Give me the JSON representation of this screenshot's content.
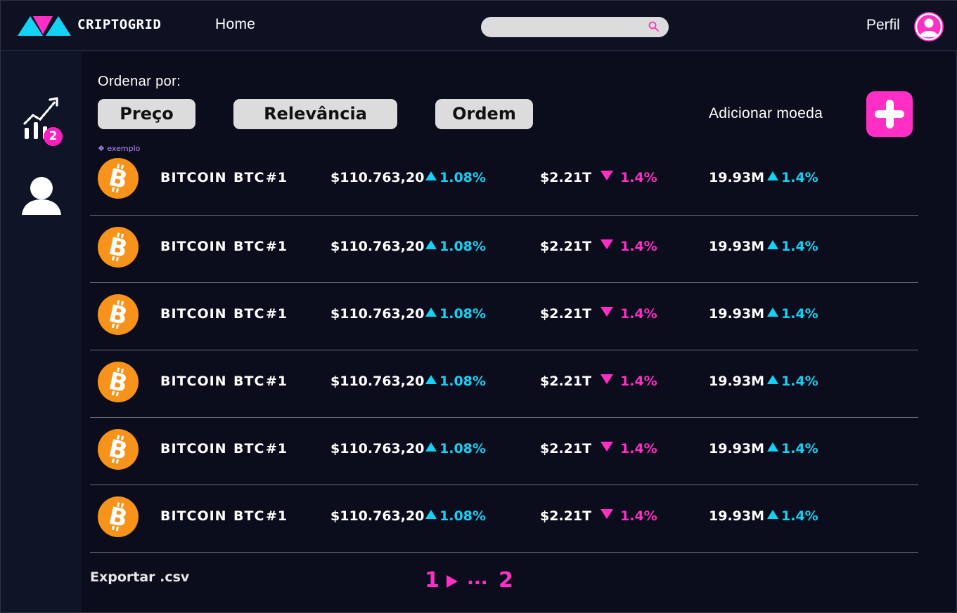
{
  "header": {
    "brand": "CRIPTOGRID",
    "nav_home": "Home",
    "search_placeholder": "",
    "profile_label": "Perfil"
  },
  "sidebar": {
    "badge_count": "2"
  },
  "toolbar": {
    "sort_label": "Ordenar por:",
    "sort_buttons": [
      "Preço",
      "Relevância",
      "Ordem"
    ],
    "add_label": "Adicionar moeda",
    "example_tag": "❖ exemplo"
  },
  "colors": {
    "accent_pink": "#ff2fc6",
    "accent_cyan": "#14d2f5",
    "bitcoin_orange": "#f7931a"
  },
  "coins": [
    {
      "name": "BITCOIN",
      "symbol": "BTC",
      "rank": "#1",
      "price": "$110.763,20",
      "change_price": "1.08%",
      "market_cap": "$2.21T",
      "change_cap": "1.4%",
      "volume": "19.93M",
      "change_volume": "1.4%"
    },
    {
      "name": "BITCOIN",
      "symbol": "BTC",
      "rank": "#1",
      "price": "$110.763,20",
      "change_price": "1.08%",
      "market_cap": "$2.21T",
      "change_cap": "1.4%",
      "volume": "19.93M",
      "change_volume": "1.4%"
    },
    {
      "name": "BITCOIN",
      "symbol": "BTC",
      "rank": "#1",
      "price": "$110.763,20",
      "change_price": "1.08%",
      "market_cap": "$2.21T",
      "change_cap": "1.4%",
      "volume": "19.93M",
      "change_volume": "1.4%"
    },
    {
      "name": "BITCOIN",
      "symbol": "BTC",
      "rank": "#1",
      "price": "$110.763,20",
      "change_price": "1.08%",
      "market_cap": "$2.21T",
      "change_cap": "1.4%",
      "volume": "19.93M",
      "change_volume": "1.4%"
    },
    {
      "name": "BITCOIN",
      "symbol": "BTC",
      "rank": "#1",
      "price": "$110.763,20",
      "change_price": "1.08%",
      "market_cap": "$2.21T",
      "change_cap": "1.4%",
      "volume": "19.93M",
      "change_volume": "1.4%"
    },
    {
      "name": "BITCOIN",
      "symbol": "BTC",
      "rank": "#1",
      "price": "$110.763,20",
      "change_price": "1.08%",
      "market_cap": "$2.21T",
      "change_cap": "1.4%",
      "volume": "19.93M",
      "change_volume": "1.4%"
    }
  ],
  "footer": {
    "export_label": "Exportar .csv",
    "page_current": "1",
    "page_ellipsis": "...",
    "page_last": "2"
  }
}
